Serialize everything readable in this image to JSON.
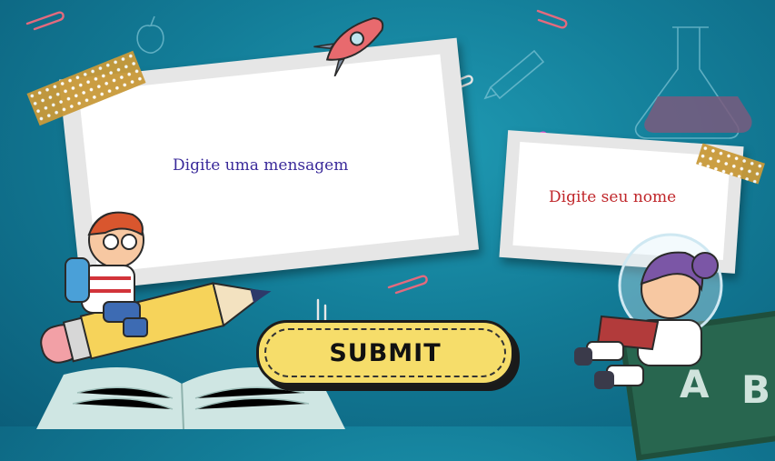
{
  "message_card": {
    "placeholder": "Digite uma mensagem"
  },
  "name_card": {
    "placeholder": "Digite seu nome"
  },
  "submit": {
    "label": "SUBMIT"
  },
  "board": {
    "letters": [
      "A",
      "B"
    ]
  },
  "colors": {
    "message_text": "#3a2a9a",
    "name_text": "#c0262a",
    "button": "#f6dd6a"
  }
}
